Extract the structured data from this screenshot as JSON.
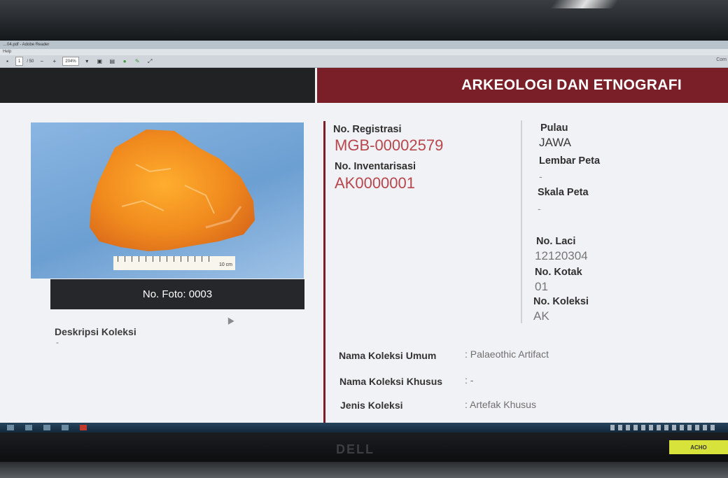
{
  "window": {
    "title": "…04.pdf - Adobe Reader",
    "menu": "Help"
  },
  "toolbar": {
    "page_current": "1",
    "page_total": "/ 50",
    "zoom": "204%",
    "right_label": "Com"
  },
  "header": {
    "title": "ARKEOLOGI DAN ETNOGRAFI"
  },
  "photo": {
    "caption": "No. Foto: 0003",
    "ruler_label": "10 cm"
  },
  "description": {
    "label": "Deskripsi Koleksi",
    "value": "-"
  },
  "registration": {
    "reg_label": "No. Registrasi",
    "reg_value": "MGB-00002579",
    "inv_label": "No. Inventarisasi",
    "inv_value": "AK0000001"
  },
  "location": {
    "pulau_label": "Pulau",
    "pulau_value": "JAWA",
    "lembar_label": "Lembar Peta",
    "lembar_value": "-",
    "skala_label": "Skala Peta",
    "skala_value": "-"
  },
  "storage": {
    "laci_label": "No. Laci",
    "laci_value": "12120304",
    "kotak_label": "No. Kotak",
    "kotak_value": "01",
    "koleksi_label": "No. Koleksi",
    "koleksi_value": "AK"
  },
  "fields": {
    "umum_label": "Nama Koleksi Umum",
    "umum_value": ": Palaeothic Artifact",
    "khusus_label": "Nama Koleksi Khusus",
    "khusus_value": ": -",
    "jenis_label": "Jenis Koleksi",
    "jenis_value": ": Artefak Khusus"
  },
  "monitor": {
    "brand": "DELL",
    "sticker": "ACHO"
  },
  "colors": {
    "accent_maroon": "#7a1f27",
    "value_red": "#b7474c",
    "artifact_orange": "#f08a1e"
  }
}
